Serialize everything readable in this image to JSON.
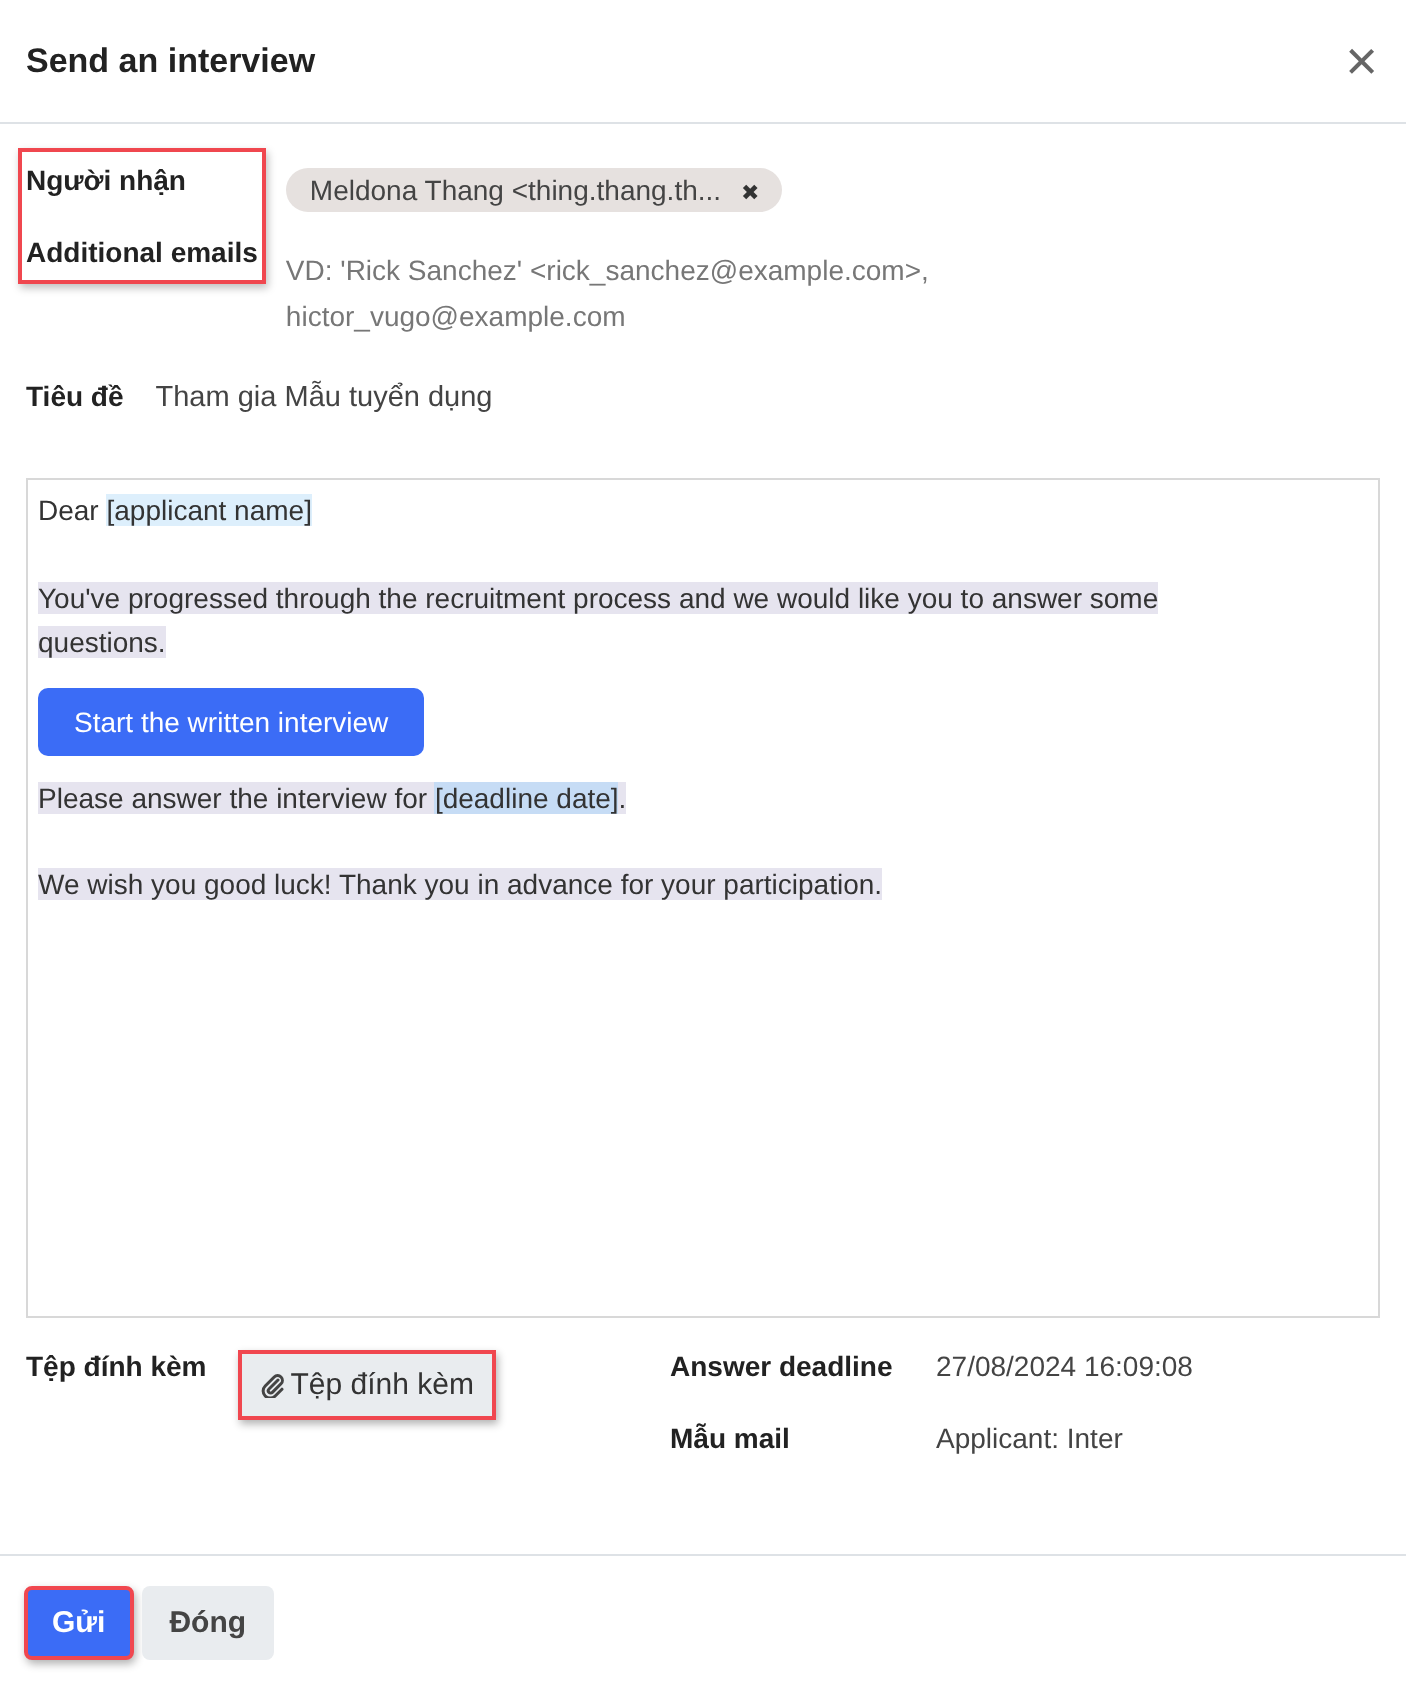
{
  "dialog": {
    "title": "Send an interview",
    "close": "×"
  },
  "recipients": {
    "highlighted": true,
    "fields": [
      {
        "label": "Người nhận",
        "kind": "tags",
        "tags": [
          {
            "text": "Meldona Thang <thing.thang.th...",
            "remove": "✖"
          }
        ]
      },
      {
        "label": "Additional emails",
        "kind": "placeholder",
        "placeholder": "VD:  'Rick Sanchez' <rick_sanchez@example.com>, hictor_vugo@example.com"
      }
    ]
  },
  "subject": {
    "label": "Tiêu đề",
    "value": "Tham gia Mẫu tuyển dụng"
  },
  "body": {
    "selected": true,
    "blocks": [
      {
        "kind": "text",
        "parts": [
          {
            "text": "Dear ",
            "placeholder": false
          },
          {
            "text": "[applicant name]",
            "placeholder": true
          }
        ]
      },
      {
        "kind": "text",
        "parts": [
          {
            "text": "You've progressed through the recruitment process and we would like you to answer some questions.",
            "placeholder": false
          }
        ]
      },
      {
        "kind": "button",
        "text": "Start the written interview"
      },
      {
        "kind": "text",
        "parts": [
          {
            "text": "Please answer the interview for ",
            "placeholder": false
          },
          {
            "text": "[deadline date]",
            "placeholder": true
          },
          {
            "text": ".",
            "placeholder": false
          }
        ]
      },
      {
        "kind": "text",
        "parts": [
          {
            "text": "We wish you good luck! Thank you in advance for your participation.",
            "placeholder": false
          }
        ]
      }
    ]
  },
  "attachments": {
    "label": "Tệp đính kèm",
    "button": "Tệp đính kèm",
    "highlighted": true
  },
  "side_fields": [
    {
      "label": "Answer deadline",
      "value": "27/08/2024 16:09:08"
    },
    {
      "label": "Mẫu mail",
      "value": "Applicant: Inter"
    }
  ],
  "footer": {
    "buttons": [
      {
        "text": "Gửi",
        "primary": true,
        "highlighted": true
      },
      {
        "text": "Đóng",
        "primary": false,
        "highlighted": false
      }
    ]
  }
}
